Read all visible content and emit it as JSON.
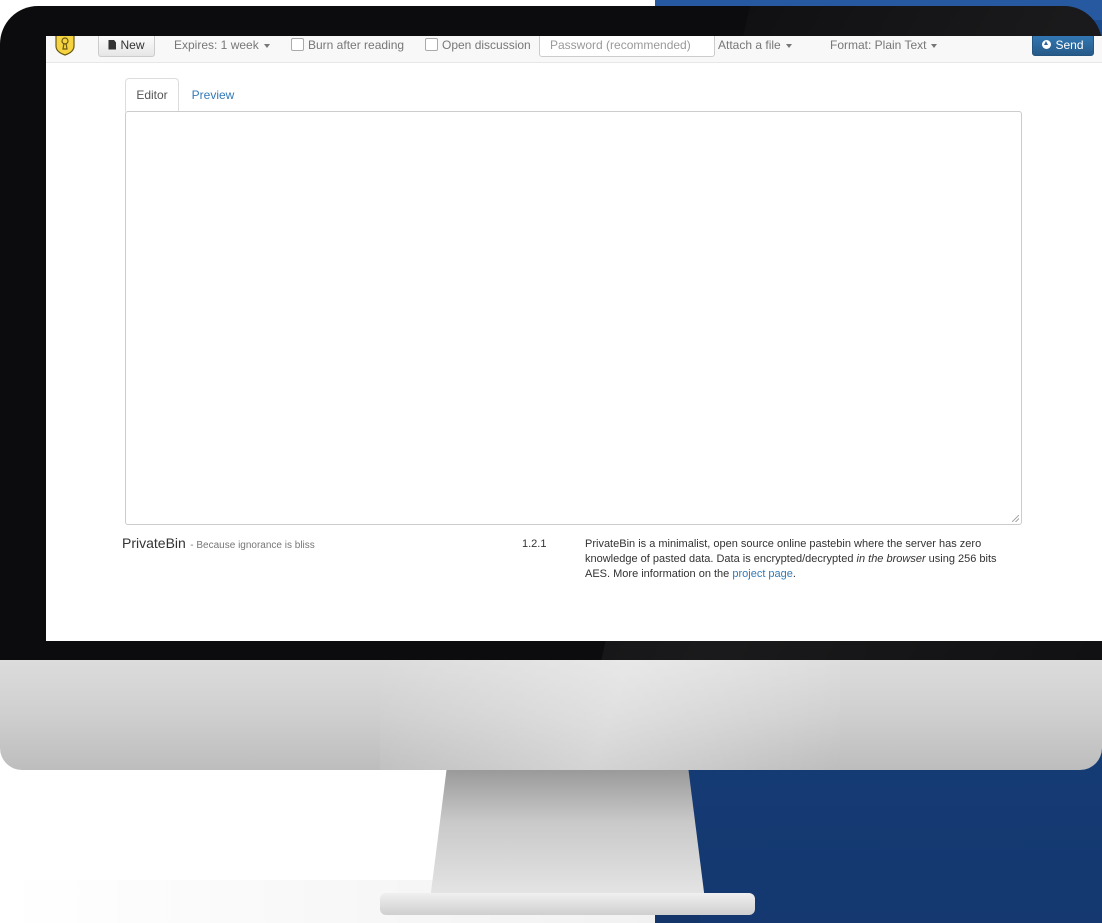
{
  "toolbar": {
    "new_label": "New",
    "expires_label": "Expires: 1 week",
    "burn_label": "Burn after reading",
    "discussion_label": "Open discussion",
    "password_placeholder": "Password (recommended)",
    "attach_label": "Attach a file",
    "format_label": "Format: Plain Text",
    "send_label": "Send"
  },
  "tabs": {
    "editor": "Editor",
    "preview": "Preview"
  },
  "editor": {
    "value": ""
  },
  "footer": {
    "brand": "PrivateBin",
    "tagline": "- Because ignorance is bliss",
    "version": "1.2.1",
    "about_part1": "PrivateBin is a minimalist, open source online pastebin where the server has zero knowledge of pasted data. Data is encrypted/decrypted ",
    "about_em": "in the browser",
    "about_part2": " using 256 bits AES. More information on the ",
    "about_link": "project page",
    "about_end": "."
  },
  "colors": {
    "accent": "#337ab7",
    "background_blue": "#1b4b8f",
    "logo_yellow": "#f5d341"
  }
}
